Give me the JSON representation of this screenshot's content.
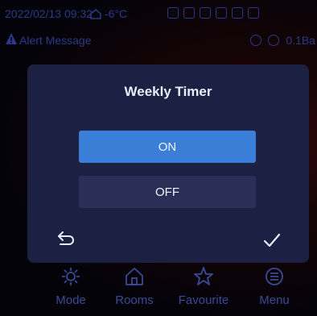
{
  "status": {
    "datetime": "2022/02/13 09:32",
    "outdoor_temp": "-6°C"
  },
  "alert": {
    "text": "Alert Message",
    "pressure": "0.1Ba"
  },
  "dialog": {
    "title": "Weekly Timer",
    "on_label": "ON",
    "off_label": "OFF",
    "selected": "ON"
  },
  "nav": {
    "mode": "Mode",
    "rooms": "Rooms",
    "favourite": "Favourite",
    "menu": "Menu"
  },
  "colors": {
    "accent": "#3a7ed8",
    "dialog_bg": "#1c2042"
  }
}
